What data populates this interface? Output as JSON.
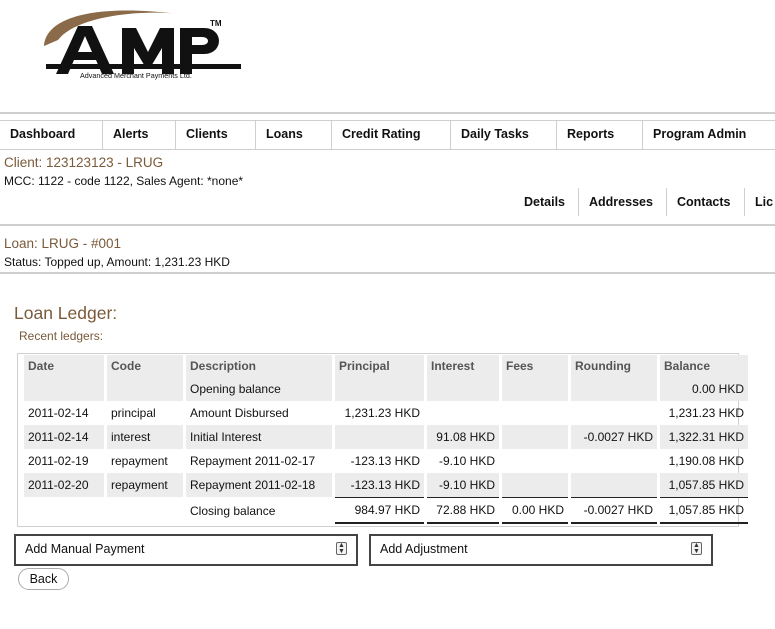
{
  "logo": {
    "letters": "AMP",
    "tm": "TM",
    "tagline": "Advanced Merchant Payments Ltd."
  },
  "nav": {
    "items": [
      "Dashboard",
      "Alerts",
      "Clients",
      "Loans",
      "Credit Rating",
      "Daily Tasks",
      "Reports",
      "Program Admin"
    ]
  },
  "client": {
    "title": "Client: 123123123 - LRUG",
    "subtitle": "MCC: 1122 - code 1122, Sales Agent: *none*",
    "tabs": [
      "Details",
      "Addresses",
      "Contacts",
      "Lic"
    ]
  },
  "loan": {
    "title": "Loan: LRUG - #001",
    "status": "Status: Topped up, Amount: 1,231.23 HKD"
  },
  "ledger": {
    "title": "Loan Ledger:",
    "subtitle": "Recent ledgers:",
    "headers": [
      "Date",
      "Code",
      "Description",
      "Principal",
      "Interest",
      "Fees",
      "Rounding",
      "Balance"
    ],
    "rows": [
      [
        "",
        "",
        "Opening balance",
        "",
        "",
        "",
        "",
        "0.00 HKD"
      ],
      [
        "2011-02-14",
        "principal",
        "Amount Disbursed",
        "1,231.23 HKD",
        "",
        "",
        "",
        "1,231.23 HKD"
      ],
      [
        "2011-02-14",
        "interest",
        "Initial Interest",
        "",
        "91.08 HKD",
        "",
        "-0.0027 HKD",
        "1,322.31 HKD"
      ],
      [
        "2011-02-19",
        "repayment",
        "Repayment 2011-02-17",
        "-123.13 HKD",
        "-9.10 HKD",
        "",
        "",
        "1,190.08 HKD"
      ],
      [
        "2011-02-20",
        "repayment",
        "Repayment 2011-02-18",
        "-123.13 HKD",
        "-9.10 HKD",
        "",
        "",
        "1,057.85 HKD"
      ]
    ],
    "closing": [
      "",
      "",
      "Closing balance",
      "984.97 HKD",
      "72.88 HKD",
      "0.00 HKD",
      "-0.0027 HKD",
      "1,057.85 HKD"
    ]
  },
  "actions": {
    "manual_payment": "Add Manual Payment",
    "adjustment": "Add Adjustment",
    "back": "Back"
  }
}
